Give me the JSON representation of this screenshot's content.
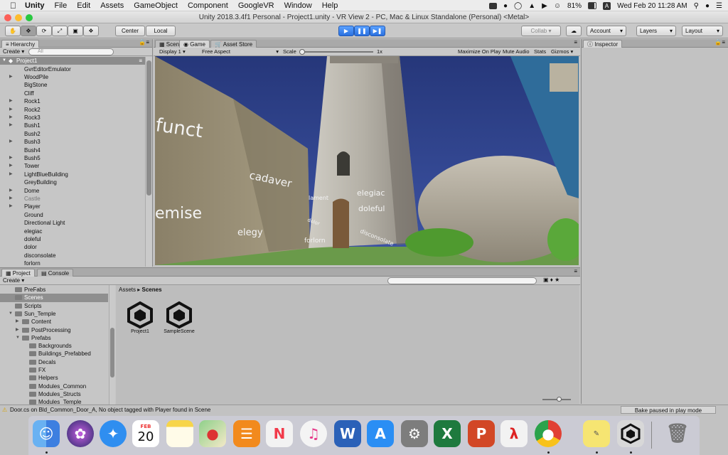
{
  "menubar": {
    "app": "Unity",
    "items": [
      "File",
      "Edit",
      "Assets",
      "GameObject",
      "Component",
      "GoogleVR",
      "Window",
      "Help"
    ],
    "battery": "81%",
    "clock": "Wed Feb 20  11:28 AM"
  },
  "window_title": "Unity 2018.3.4f1 Personal - Project1.unity - VR View 2 - PC, Mac & Linux Standalone (Personal) <Metal>",
  "toolbar": {
    "center": "Center",
    "local": "Local",
    "collab": "Collab",
    "account": "Account",
    "layers": "Layers",
    "layout": "Layout"
  },
  "hierarchy": {
    "tab": "Hierarchy",
    "create": "Create",
    "search_placeholder": "All",
    "root": "Project1",
    "items": [
      {
        "label": "GvrEditorEmulator",
        "arrow": false
      },
      {
        "label": "WoodPile",
        "arrow": true
      },
      {
        "label": "BigStone",
        "arrow": false
      },
      {
        "label": "Cliff",
        "arrow": false
      },
      {
        "label": "Rock1",
        "arrow": true
      },
      {
        "label": "Rock2",
        "arrow": true
      },
      {
        "label": "Rock3",
        "arrow": true
      },
      {
        "label": "Bush1",
        "arrow": true
      },
      {
        "label": "Bush2",
        "arrow": false
      },
      {
        "label": "Bush3",
        "arrow": true
      },
      {
        "label": "Bush4",
        "arrow": false
      },
      {
        "label": "Bush5",
        "arrow": true
      },
      {
        "label": "Tower",
        "arrow": true
      },
      {
        "label": "LightBlueBuilding",
        "arrow": true
      },
      {
        "label": "GreyBuilding",
        "arrow": false
      },
      {
        "label": "Dome",
        "arrow": true
      },
      {
        "label": "Castle",
        "arrow": true
      },
      {
        "label": "Player",
        "arrow": true
      },
      {
        "label": "Ground",
        "arrow": false
      },
      {
        "label": "Directional Light",
        "arrow": false
      },
      {
        "label": "elegiac",
        "arrow": false
      },
      {
        "label": "doleful",
        "arrow": false
      },
      {
        "label": "dolor",
        "arrow": false
      },
      {
        "label": "disconsolate",
        "arrow": false
      },
      {
        "label": "forlorn",
        "arrow": false
      }
    ]
  },
  "game": {
    "tabs": [
      "Scene",
      "Game",
      "Asset Store"
    ],
    "display": "Display 1",
    "aspect": "Free Aspect",
    "scale_label": "Scale",
    "scale_value": "1x",
    "maximize": "Maximize On Play",
    "mute": "Mute Audio",
    "stats": "Stats",
    "gizmos": "Gizmos",
    "words": [
      "funct",
      "cadaver",
      "emise",
      "elegy",
      "lament",
      "elegiac",
      "doleful",
      "dolor",
      "forlorn",
      "disconsolate"
    ]
  },
  "inspector": {
    "tab": "Inspector"
  },
  "project": {
    "tabs": [
      "Project",
      "Console"
    ],
    "create": "Create",
    "folders": [
      {
        "label": "PreFabs",
        "depth": 1,
        "arrow": false
      },
      {
        "label": "Scenes",
        "depth": 1,
        "arrow": false
      },
      {
        "label": "Scripts",
        "depth": 1,
        "arrow": false
      },
      {
        "label": "Sun_Temple",
        "depth": 1,
        "arrow": true
      },
      {
        "label": "Content",
        "depth": 2,
        "arrow": true
      },
      {
        "label": "PostProcessing",
        "depth": 2,
        "arrow": true
      },
      {
        "label": "Prefabs",
        "depth": 2,
        "arrow": true
      },
      {
        "label": "Backgrounds",
        "depth": 3,
        "arrow": false
      },
      {
        "label": "Buildings_Prefabbed",
        "depth": 3,
        "arrow": false
      },
      {
        "label": "Decals",
        "depth": 3,
        "arrow": false
      },
      {
        "label": "FX",
        "depth": 3,
        "arrow": false
      },
      {
        "label": "Helpers",
        "depth": 3,
        "arrow": false
      },
      {
        "label": "Modules_Common",
        "depth": 3,
        "arrow": false
      },
      {
        "label": "Modules_Structs",
        "depth": 3,
        "arrow": false
      },
      {
        "label": "Modules_Temple",
        "depth": 3,
        "arrow": false
      }
    ],
    "breadcrumb": [
      "Assets",
      "Scenes"
    ],
    "assets": [
      "Project1",
      "SampleScene"
    ]
  },
  "status": {
    "message": "Door.cs on Bld_Common_Door_A, No object tagged with Player found in Scene",
    "right": "Bake paused in play mode"
  },
  "dock": {
    "calendar_month": "FEB",
    "calendar_day": "20",
    "apps": [
      "Finder",
      "Siri",
      "Safari",
      "Calendar",
      "Notes",
      "Maps",
      "Books",
      "News",
      "iTunes",
      "Word",
      "App Store",
      "System Preferences",
      "Excel",
      "PowerPoint",
      "Acrobat",
      "Chrome",
      "Stickies",
      "Unity",
      "Trash"
    ]
  }
}
